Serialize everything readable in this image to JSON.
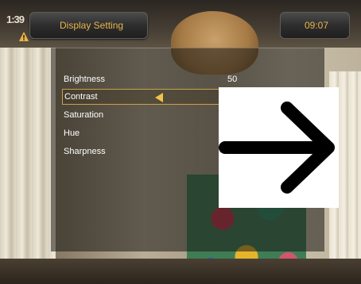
{
  "header": {
    "channel_tag": "1:39",
    "title": "Display Setting",
    "clock": "09:07"
  },
  "menu": {
    "items": [
      {
        "label": "Brightness",
        "value": "50"
      },
      {
        "label": "Contrast",
        "value": ""
      },
      {
        "label": "Saturation",
        "value": ""
      },
      {
        "label": "Hue",
        "value": ""
      },
      {
        "label": "Sharpness",
        "value": ""
      }
    ],
    "selected_index": 1
  },
  "icons": {
    "warning": "warning-triangle-icon",
    "selector": "left-triangle-icon",
    "overlay": "right-arrow-icon"
  },
  "colors": {
    "accent": "#e9b64a",
    "selection_border": "#c9a24a",
    "text": "#ffffff"
  }
}
